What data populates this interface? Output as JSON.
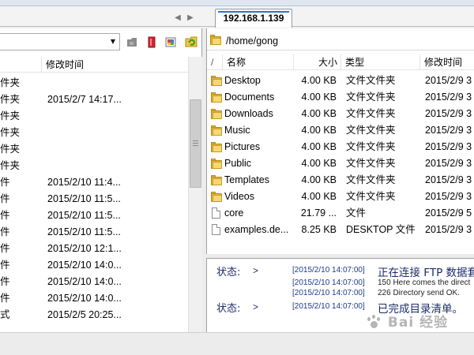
{
  "tabs": {
    "active_label": "192.168.1.139"
  },
  "left": {
    "header": {
      "name": "",
      "modified": "修改时间"
    },
    "rows": [
      {
        "type": "件夹",
        "date": ""
      },
      {
        "type": "件夹",
        "date": "2015/2/7 14:17..."
      },
      {
        "type": "件夹",
        "date": ""
      },
      {
        "type": "件夹",
        "date": ""
      },
      {
        "type": "件夹",
        "date": ""
      },
      {
        "type": "件夹",
        "date": ""
      },
      {
        "type": "件",
        "date": "2015/2/10 11:4..."
      },
      {
        "type": "件",
        "date": "2015/2/10 11:5..."
      },
      {
        "type": "件",
        "date": "2015/2/10 11:5..."
      },
      {
        "type": "件",
        "date": "2015/2/10 11:5..."
      },
      {
        "type": "件",
        "date": "2015/2/10 12:1..."
      },
      {
        "type": "件",
        "date": "2015/2/10 14:0..."
      },
      {
        "type": "件",
        "date": "2015/2/10 14:0..."
      },
      {
        "type": "件",
        "date": "2015/2/10 14:0..."
      },
      {
        "type": "式",
        "date": "2015/2/5 20:25..."
      }
    ]
  },
  "right": {
    "path": "/home/gong",
    "header": {
      "sort": "/",
      "name": "名称",
      "size": "大小",
      "type": "类型",
      "modified": "修改时间"
    },
    "rows": [
      {
        "icon": "folder-icon",
        "name": "Desktop",
        "size": "4.00 KB",
        "type": "文件文件夹",
        "modified": "2015/2/9 3"
      },
      {
        "icon": "folder-icon",
        "name": "Documents",
        "size": "4.00 KB",
        "type": "文件文件夹",
        "modified": "2015/2/9 3"
      },
      {
        "icon": "folder-icon",
        "name": "Downloads",
        "size": "4.00 KB",
        "type": "文件文件夹",
        "modified": "2015/2/9 3"
      },
      {
        "icon": "folder-icon",
        "name": "Music",
        "size": "4.00 KB",
        "type": "文件文件夹",
        "modified": "2015/2/9 3"
      },
      {
        "icon": "folder-icon",
        "name": "Pictures",
        "size": "4.00 KB",
        "type": "文件文件夹",
        "modified": "2015/2/9 3"
      },
      {
        "icon": "folder-icon",
        "name": "Public",
        "size": "4.00 KB",
        "type": "文件文件夹",
        "modified": "2015/2/9 3"
      },
      {
        "icon": "folder-icon",
        "name": "Templates",
        "size": "4.00 KB",
        "type": "文件文件夹",
        "modified": "2015/2/9 3"
      },
      {
        "icon": "folder-icon",
        "name": "Videos",
        "size": "4.00 KB",
        "type": "文件文件夹",
        "modified": "2015/2/9 3"
      },
      {
        "icon": "file-icon",
        "name": "core",
        "size": "21.79 ...",
        "type": "文件",
        "modified": "2015/2/9 5"
      },
      {
        "icon": "file-icon",
        "name": "examples.de...",
        "size": "8.25 KB",
        "type": "DESKTOP 文件",
        "modified": "2015/2/9 3"
      }
    ]
  },
  "log": {
    "lines": [
      {
        "label": "状态:",
        "arrow": ">",
        "time": "[2015/2/10 14:07:00]",
        "msg": "正在连接 FTP 数据套",
        "style": "big"
      },
      {
        "label": "",
        "arrow": "",
        "time": "[2015/2/10 14:07:00]",
        "msg": "150 Here comes the direct",
        "style": "small"
      },
      {
        "label": "",
        "arrow": "",
        "time": "[2015/2/10 14:07:00]",
        "msg": "226 Directory send OK.",
        "style": "small"
      },
      {
        "label": "状态:",
        "arrow": ">",
        "time": "[2015/2/10 14:07:00]",
        "msg": "已完成目录清单。",
        "style": "big"
      }
    ]
  },
  "watermark": {
    "text": "Bai 经验"
  },
  "colors": {
    "accent": "#2e76c7",
    "folder": "#e6b53c",
    "log_text": "#1d2b6b"
  }
}
